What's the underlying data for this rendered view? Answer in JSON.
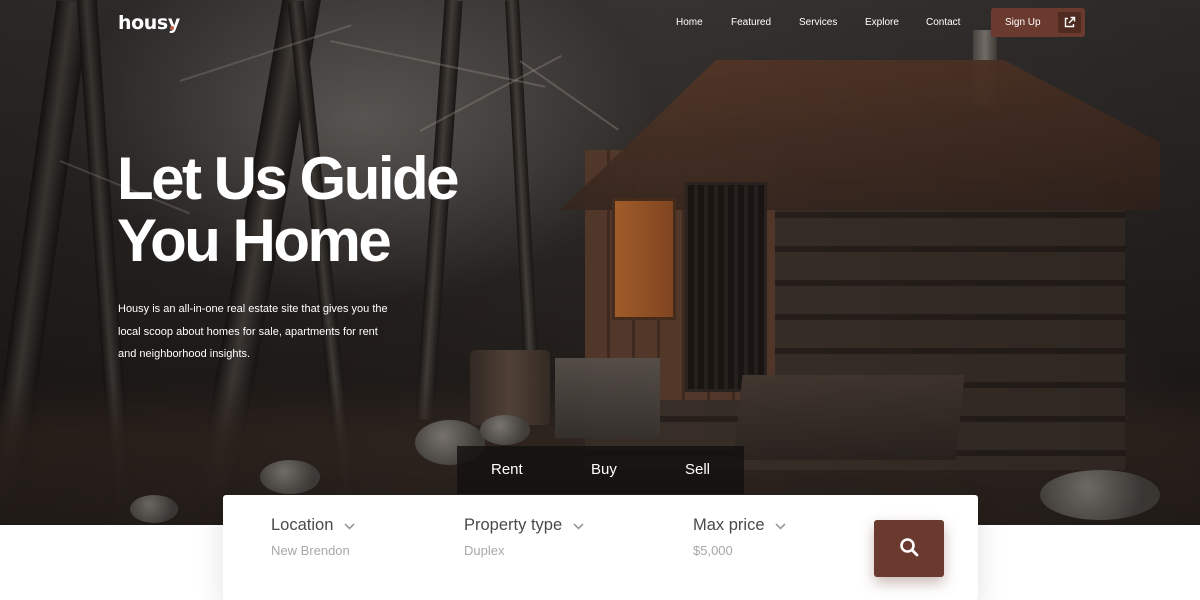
{
  "brand": {
    "logo": "housy",
    "accent": "#6b3a2e",
    "dot_color": "#c0614a"
  },
  "nav": {
    "items": [
      {
        "label": "Home"
      },
      {
        "label": "Featured"
      },
      {
        "label": "Services"
      },
      {
        "label": "Explore"
      },
      {
        "label": "Contact"
      }
    ],
    "signup_label": "Sign Up",
    "signup_icon": "external-link-icon"
  },
  "hero": {
    "headline_line1": "Let Us Guide",
    "headline_line2": "You Home",
    "lead_line1": "Housy is an all-in-one real estate site that gives you the",
    "lead_line2": "local scoop about homes for sale, apartments for rent",
    "lead_line3": "and neighborhood insights.",
    "background": "forest-cabin-photo"
  },
  "search": {
    "tabs": [
      {
        "label": "Rent"
      },
      {
        "label": "Buy"
      },
      {
        "label": "Sell"
      }
    ],
    "fields": [
      {
        "label": "Location",
        "value": "New Brendon",
        "icon": "chevron-down-icon"
      },
      {
        "label": "Property type",
        "value": "Duplex",
        "icon": "chevron-down-icon"
      },
      {
        "label": "Max price",
        "value": "$5,000",
        "icon": "chevron-down-icon"
      }
    ],
    "submit_icon": "search-icon"
  }
}
